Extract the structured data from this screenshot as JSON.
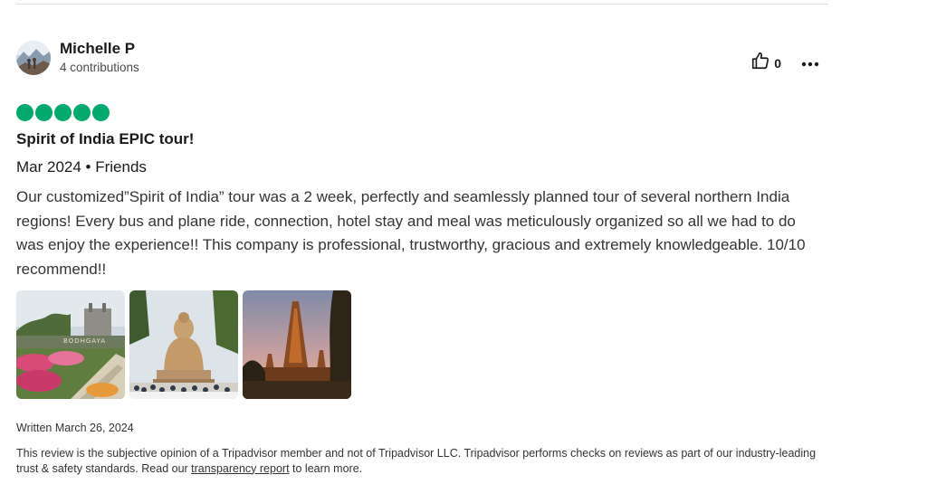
{
  "review": {
    "user": {
      "name": "Michelle P",
      "contributions": "4 contributions"
    },
    "helpful_count": "0",
    "rating_bubbles": 5,
    "accent_color": "#00aa6c",
    "title": "Spirit of India EPIC tour!",
    "trip_meta": "Mar 2024 • Friends",
    "body": "Our customized”Spirit of India” tour was a 2 week, perfectly and seamlessly planned tour of several northern India regions! Every bus and plane ride, connection, hotel stay and meal was meticulously organized so all we had to do was enjoy the experience!! This company is professional, trustworthy, gracious and extremely knowledgeable. 10/10 recommend!!",
    "photos": [
      {
        "subject": "garden with flower beds and a monument sign"
      },
      {
        "subject": "large seated Buddha statue with crowd"
      },
      {
        "subject": "temple spire at dusk"
      }
    ],
    "written_date": "Written March 26, 2024",
    "disclaimer_before": "This review is the subjective opinion of a Tripadvisor member and not of Tripadvisor LLC. Tripadvisor performs checks on reviews as part of our industry-leading trust & safety standards. Read our ",
    "disclaimer_link": "transparency report",
    "disclaimer_after": " to learn more."
  },
  "icons": {
    "helpful": "thumbs-up-icon",
    "more": "more-options-icon"
  }
}
